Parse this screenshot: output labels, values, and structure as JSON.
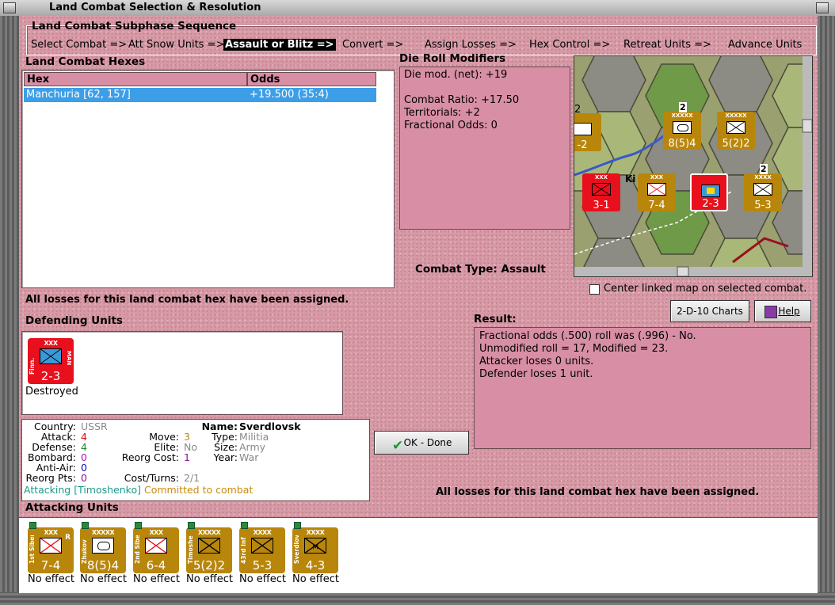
{
  "window": {
    "title": "Land Combat Selection & Resolution"
  },
  "sequence": {
    "title": "Land Combat Subphase Sequence",
    "items": [
      "Select Combat =>",
      "Att Snow Units =>",
      "Assault or Blitz =>",
      "Convert =>",
      "Assign Losses =>",
      "Hex Control =>",
      "Retreat Units =>",
      "Advance Units"
    ],
    "active_index": 2
  },
  "hexes": {
    "title": "Land Combat Hexes",
    "columns": [
      "Hex",
      "Odds"
    ],
    "rows": [
      {
        "hex": "Manchuria [62, 157]",
        "odds": "+19.500 (35:4)"
      }
    ]
  },
  "die_roll": {
    "title": "Die Roll Modifiers",
    "lines": [
      "Die mod. (net): +19",
      "",
      "Combat Ratio: +17.50",
      "Territorials: +2",
      "Fractional Odds: 0"
    ]
  },
  "combat_type": {
    "label": "Combat Type:",
    "value": "Assault"
  },
  "center_map": {
    "label": "Center linked map on selected combat.",
    "checked": false
  },
  "buttons": {
    "charts": "2-D-10 Charts",
    "help": "Help",
    "ok": "OK - Done"
  },
  "status_losses": "All losses for this land combat hex have been assigned.",
  "defending": {
    "title": "Defending Units",
    "units": [
      {
        "name": "Finn.",
        "size": "XXX",
        "strength": "2-3",
        "mark": "MAN",
        "color": "#e8101c",
        "status": "Destroyed"
      }
    ]
  },
  "result": {
    "title": "Result:",
    "lines": [
      "Fractional odds (.500) roll was (.996)  - No.",
      "Unmodified roll = 17, Modified = 23.",
      "Attacker loses 0 units.",
      "Defender loses 1 unit."
    ]
  },
  "unit_info": {
    "country_label": "Country:",
    "country": "USSR",
    "attack_label": "Attack:",
    "attack": "4",
    "defense_label": "Defense:",
    "defense": "4",
    "bombard_label": "Bombard:",
    "bombard": "0",
    "antiair_label": "Anti-Air:",
    "antiair": "0",
    "reorg_pts_label": "Reorg Pts:",
    "reorg_pts": "0",
    "move_label": "Move:",
    "move": "3",
    "elite_label": "Elite:",
    "elite": "No",
    "reorg_cost_label": "Reorg Cost:",
    "reorg_cost": "1",
    "cost_turns_label": "Cost/Turns:",
    "cost_turns": "2/1",
    "name_label": "Name:",
    "name": "Sverdlovsk",
    "type_label": "Type:",
    "type": "Militia",
    "size_label": "Size:",
    "size": "Army",
    "year_label": "Year:",
    "year": "War",
    "attacking_text": "Attacking [Timoshenko]",
    "committed_text": "Committed to combat"
  },
  "attacking": {
    "title": "Attacking Units",
    "units": [
      {
        "name": "1st Siberian",
        "size": "XXX",
        "strength": "7-4",
        "mark": "R",
        "symbol": "inf-x",
        "status": "No effect"
      },
      {
        "name": "Zhukov",
        "size": "XXXXX",
        "strength": "8(5)4",
        "mark": "",
        "symbol": "armor",
        "status": "No effect"
      },
      {
        "name": "2nd Siberian",
        "size": "XXX",
        "strength": "6-4",
        "mark": "",
        "symbol": "inf-x",
        "status": "No effect"
      },
      {
        "name": "Timoshenko",
        "size": "XXXXX",
        "strength": "5(2)2",
        "mark": "",
        "symbol": "inf",
        "status": "No effect"
      },
      {
        "name": "43rd Inf",
        "size": "XXXX",
        "strength": "5-3",
        "mark": "",
        "symbol": "inf",
        "status": "No effect"
      },
      {
        "name": "Sverdlovsk",
        "size": "XXXX",
        "strength": "4-3",
        "mark": "",
        "symbol": "militia",
        "status": "No effect"
      }
    ]
  },
  "map": {
    "labels": [
      "Ki"
    ],
    "stack_counts": [
      "2",
      "2",
      "2"
    ],
    "units": [
      {
        "name": "Zhukov",
        "strength": "8(5)4",
        "color": "#b8860b",
        "size": "XXXXX"
      },
      {
        "name": "Timoshenko",
        "strength": "5(2)2",
        "color": "#b8860b",
        "size": "XXXXX"
      },
      {
        "name": "",
        "strength": "3-1",
        "color": "#e8101c",
        "size": "XXX"
      },
      {
        "name": "1st Siberian",
        "strength": "7-4",
        "color": "#b8860b",
        "size": "XXX"
      },
      {
        "name": "",
        "strength": "2-3",
        "color": "#e8101c",
        "size": ""
      },
      {
        "name": "43rd Inf",
        "strength": "5-3",
        "color": "#b8860b",
        "size": "XXXX"
      },
      {
        "name": "",
        "strength": "-2",
        "color": "#b8860b",
        "size": ""
      }
    ]
  },
  "colors": {
    "panel": "#d69aa6",
    "counter_soviet": "#b8860b",
    "counter_enemy": "#e8101c",
    "selected_row": "#3d9ee8"
  }
}
